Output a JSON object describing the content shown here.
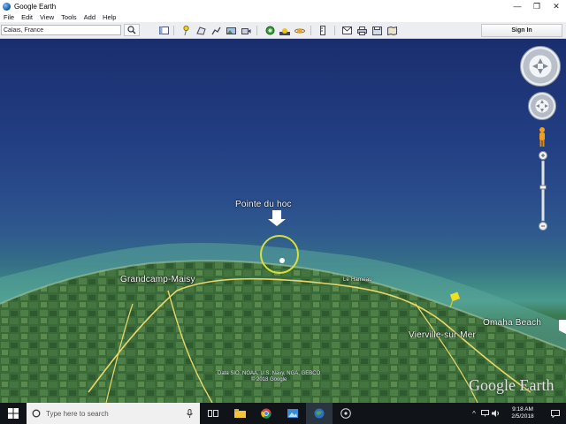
{
  "window": {
    "title": "Google Earth",
    "minimize": "—",
    "maximize": "❐",
    "close": "✕"
  },
  "menu": {
    "items": [
      "File",
      "Edit",
      "View",
      "Tools",
      "Add",
      "Help"
    ]
  },
  "search": {
    "value": "Calais, France"
  },
  "toolbar": {
    "signin_label": "Sign In"
  },
  "map": {
    "labels": {
      "pointe_du_hoc": "Pointe du hoc",
      "grandcamp": "Grandcamp-Maisy",
      "omaha": "Omaha Beach",
      "vierville": "Vierville-sur-Mer",
      "le_hameau": "Le Hameau"
    },
    "attribution_line1": "Data SIO, NOAA, U.S. Navy, NGA, GEBCO",
    "attribution_line2": "© 2018 Google",
    "logo": "Google Earth",
    "colors": {
      "ocean_deep": "#1a2e6e",
      "shore": "#4a9a8e",
      "land": "#3c6a3a",
      "road": "#e8d96a",
      "highlight_circle": "#d8e03a",
      "placemark_pin": "#f0e020"
    }
  },
  "taskbar": {
    "search_placeholder": "Type here to search",
    "time": "9:18 AM",
    "date": "2/5/2018"
  }
}
